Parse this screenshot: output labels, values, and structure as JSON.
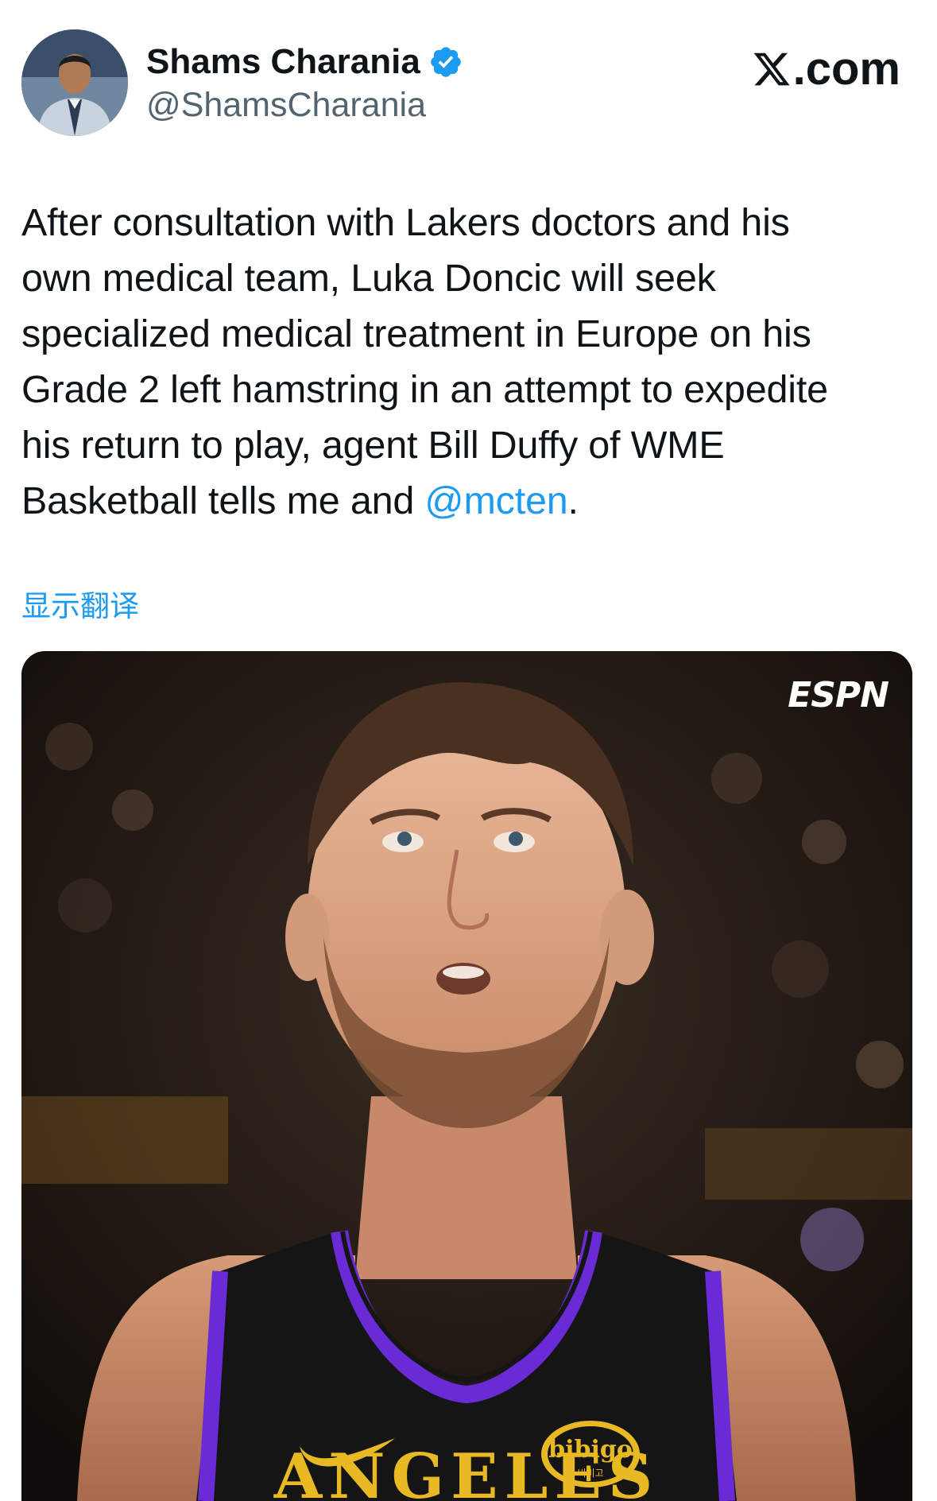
{
  "author": {
    "display_name": "Shams Charania",
    "handle": "@ShamsCharania",
    "verified": true
  },
  "brand": {
    "label": ".com",
    "logo_icon": "x-logo-icon"
  },
  "tweet": {
    "lines": [
      "After consultation with Lakers doctors and his",
      "own medical team, Luka Doncic will seek",
      "specialized medical treatment in Europe on his",
      "Grade 2 left hamstring in an attempt to expedite",
      "his return to play, agent Bill Duffy of WME"
    ],
    "last_line_prefix": "Basketball tells me and ",
    "mention": "@mcten",
    "last_line_suffix": "."
  },
  "translate_label": "显示翻译",
  "media": {
    "watermark": "ESPN",
    "jersey_sponsor": "bibigo",
    "jersey_sponsor_sub": "비비고",
    "jersey_text": "ANGELES"
  },
  "colors": {
    "text": "#0f1419",
    "secondary": "#536471",
    "link": "#1d9bf0",
    "verified": "#1d9bf0",
    "jersey_purple": "#6a2bd6",
    "jersey_gold": "#e8b923"
  }
}
